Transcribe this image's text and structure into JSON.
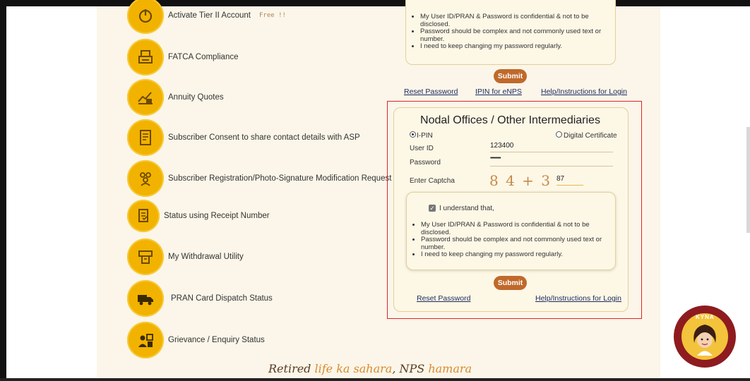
{
  "menu": [
    {
      "icon": "power-icon",
      "label": "Activate Tier II Account",
      "badge": "Free !!"
    },
    {
      "icon": "printer-icon",
      "label": "FATCA Compliance"
    },
    {
      "icon": "annuity-chart-icon",
      "label": "Annuity Quotes"
    },
    {
      "icon": "consent-document-icon",
      "label": "Subscriber Consent to share contact details with ASP"
    },
    {
      "icon": "people-group-icon",
      "label": "Subscriber Registration/Photo-Signature Modification Request"
    },
    {
      "icon": "receipt-icon",
      "label": "Status using Receipt Number"
    },
    {
      "icon": "atm-withdrawal-icon",
      "label": "My Withdrawal Utility"
    },
    {
      "icon": "delivery-truck-icon",
      "label": "PRAN Card Dispatch Status"
    },
    {
      "icon": "grievance-icon",
      "label": "Grievance / Enquiry Status"
    }
  ],
  "top_panel": {
    "bullets": [
      "My User ID/PRAN & Password is confidential & not to be disclosed.",
      "Password should be complex and not commonly used text or number.",
      "I need to keep changing my password regularly."
    ],
    "submit": "Submit",
    "links": [
      "Reset Password",
      "IPIN for eNPS",
      "Help/Instructions for Login"
    ]
  },
  "nodal_panel": {
    "title": "Nodal Offices / Other Intermediaries",
    "radio_ipin": "I-PIN",
    "radio_dc": "Digital Certificate",
    "user_id_label": "User ID",
    "user_id_value": "123400",
    "password_label": "Password",
    "password_value": "••••••••••",
    "captcha_label": "Enter Captcha",
    "captcha_image_text": "8 4 + 3 =",
    "captcha_value": "87",
    "consent_label": "I understand that,",
    "bullets": [
      "My User ID/PRAN & Password is confidential & not to be disclosed.",
      "Password should be complex and not commonly used text or number.",
      "I need to keep changing my password regularly."
    ],
    "submit": "Submit",
    "reset_link": "Reset Password",
    "help_link": "Help/Instructions for Login"
  },
  "footer": {
    "tagline_1": "Retired ",
    "tagline_2": "life ka sahara",
    "tagline_3": ", NPS ",
    "tagline_4": "hamara"
  },
  "chatbot": {
    "label": "KYNA"
  },
  "colors": {
    "accent": "#f2b200",
    "button": "#c0692b",
    "highlight_border": "#e0232a",
    "background": "#fbf6e9"
  }
}
